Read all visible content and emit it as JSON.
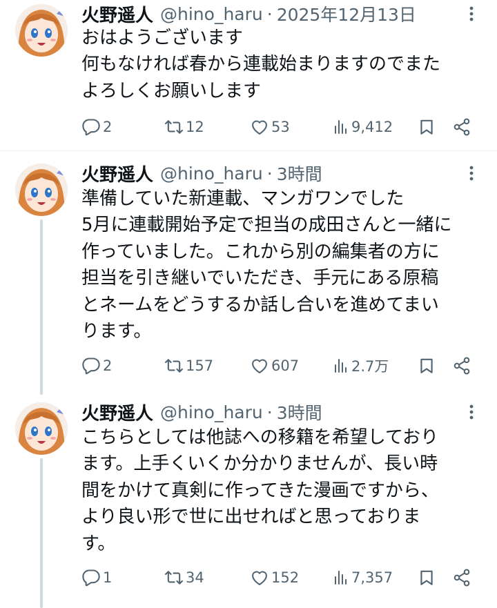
{
  "tweets": [
    {
      "name": "火野遥人",
      "handle": "@hino_haru",
      "separator": "·",
      "time": "2025年12月13日",
      "lines": [
        "おはようございます",
        "何もなければ春から連載始まりますのでまた",
        "よろしくお願いします"
      ],
      "stats": {
        "replies": "2",
        "retweets": "12",
        "likes": "53",
        "views": "9,412"
      }
    },
    {
      "name": "火野遥人",
      "handle": "@hino_haru",
      "separator": "·",
      "time": "3時間",
      "lines": [
        "準備していた新連載、マンガワンでした",
        "5月に連載開始予定で担当の成田さんと一緒に",
        "作っていました。これから別の編集者の方に",
        "担当を引き継いでいただき、手元にある原稿",
        "とネームをどうするか話し合いを進めてまい",
        "ります。"
      ],
      "stats": {
        "replies": "2",
        "retweets": "157",
        "likes": "607",
        "views": "2.7万"
      }
    },
    {
      "name": "火野遥人",
      "handle": "@hino_haru",
      "separator": "·",
      "time": "3時間",
      "lines": [
        "こちらとしては他誌への移籍を希望しており",
        "ます。上手くいくか分かりませんが、長い時",
        "間をかけて真剣に作ってきた漫画ですから、",
        "より良い形で世に出せればと思っておりま",
        "す。"
      ],
      "stats": {
        "replies": "1",
        "retweets": "34",
        "likes": "152",
        "views": "7,357"
      }
    }
  ],
  "icons": {
    "reply": "reply-icon",
    "retweet": "retweet-icon",
    "like": "heart-icon",
    "views": "views-icon",
    "bookmark": "bookmark-icon",
    "share": "share-icon",
    "more": "more-icon",
    "avatar": "avatar"
  },
  "colors": {
    "text": "#0f1419",
    "secondary": "#536471",
    "thread_line": "#cfd9de",
    "divider": "#eff3f4",
    "background": "#ffffff"
  }
}
